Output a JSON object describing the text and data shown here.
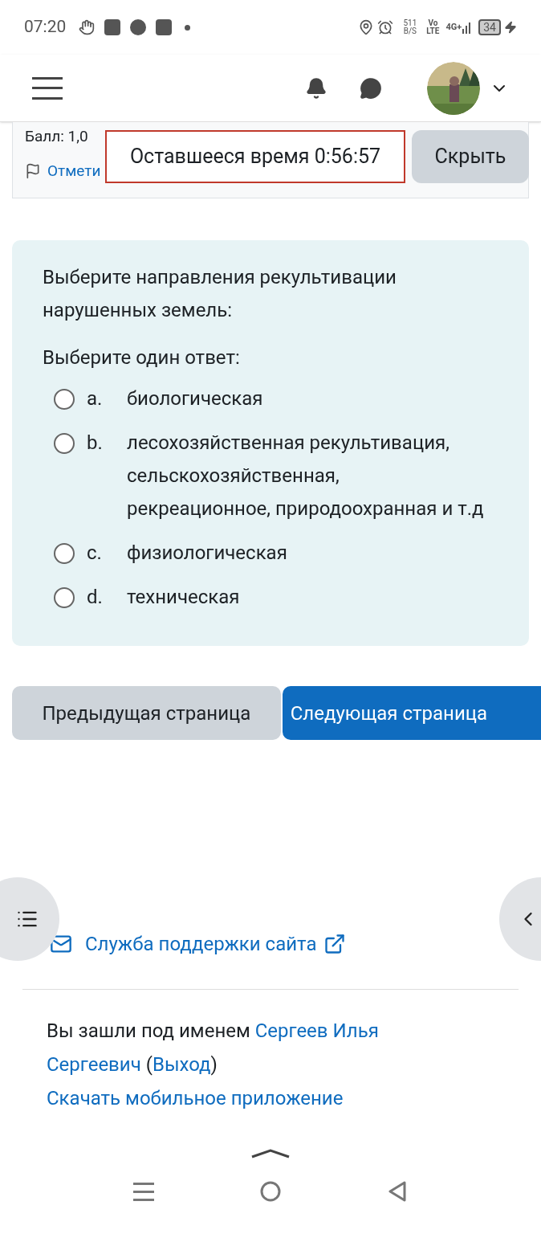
{
  "status_bar": {
    "time": "07:20",
    "net_speed": "511",
    "net_unit": "B/S",
    "volte_top": "Vo",
    "volte_bottom": "LTE",
    "network": "4G+",
    "battery": "34"
  },
  "question_info": {
    "score": "Балл: 1,0",
    "flag": "Отмети"
  },
  "timer": {
    "text": "Оставшееся время 0:56:57",
    "hide_button": "Скрыть"
  },
  "question": {
    "text": "Выберите направления рекультивации нарушенных земель:",
    "prompt": "Выберите один ответ:",
    "answers": [
      {
        "letter": "a.",
        "text": "биологическая",
        "selected": false
      },
      {
        "letter": "b.",
        "text": "лесохозяйственная рекультивация, сельскохозяйственная, рекреационное, природоохранная и т.д",
        "selected": false
      },
      {
        "letter": "c.",
        "text": "физиологическая",
        "selected": false
      },
      {
        "letter": "d.",
        "text": "техническая",
        "selected": false
      }
    ]
  },
  "navigation": {
    "previous": "Предыдущая страница",
    "next": "Следующая страница"
  },
  "footer": {
    "support": "Служба поддержки сайта",
    "logged_in": "Вы зашли под именем",
    "user_line_1": "Сергеев Илья",
    "user_line_2": "Сергеевич",
    "open_paren": "(",
    "logout": "Выход",
    "close_paren": ")",
    "app": "Скачать мобильное приложение"
  }
}
